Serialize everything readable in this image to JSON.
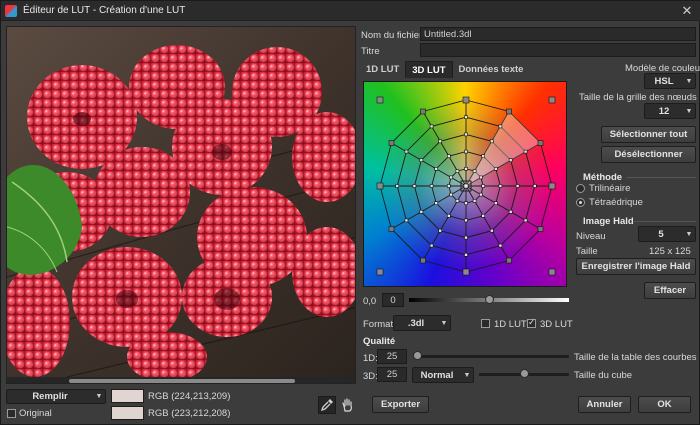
{
  "window": {
    "title": "Éditeur de LUT - Création d'une LUT"
  },
  "file": {
    "name_label": "Nom du fichier",
    "name_value": "Untitled.3dl",
    "title_label": "Titre",
    "title_value": ""
  },
  "tabs": [
    {
      "label": "1D LUT"
    },
    {
      "label": "3D LUT"
    },
    {
      "label": "Données texte"
    }
  ],
  "color_model": {
    "label": "Modèle de couleur",
    "value": "HSL"
  },
  "grid_size": {
    "label": "Taille de la grille des nœuds",
    "value": "12"
  },
  "buttons": {
    "select_all": "Sélectionner tout",
    "deselect": "Désélectionner",
    "save_hald": "Enregistrer l'image Hald",
    "clear": "Effacer",
    "export": "Exporter",
    "cancel": "Annuler",
    "ok": "OK"
  },
  "method": {
    "label": "Méthode",
    "options": [
      "Trilinéaire",
      "Tétraédrique"
    ],
    "selected": 1
  },
  "hald": {
    "label": "Image Hald",
    "level_label": "Niveau",
    "level_value": "5",
    "size_label": "Taille",
    "size_value": "125 x 125"
  },
  "brightness": {
    "label": "0,0",
    "value": "0",
    "fraction": 0.5
  },
  "format": {
    "label": "Format",
    "value": ".3dl",
    "cb_1d": "1D LUT",
    "cb_3d": "3D LUT",
    "cb_1d_checked": false,
    "cb_3d_checked": true
  },
  "quality": {
    "label": "Qualité",
    "d1_label": "1D:",
    "d1_value": "25",
    "d1_caption": "Taille de la table des courbes",
    "d1_fraction": 0.0,
    "d3_label": "3D:",
    "d3_value": "25",
    "d3_mode": "Normal",
    "d3_caption": "Taille du cube",
    "d3_fraction": 0.5
  },
  "bottom": {
    "fill_value": "Remplir",
    "rgb_current": "RGB (224,213,209)",
    "original_label": "Original",
    "rgb_original": "RGB (223,212,208)",
    "swatch_current": "#e0d5d1",
    "swatch_original": "#dfd4d0"
  },
  "colors": {
    "raspberry": "#d8283c",
    "leaf": "#3a8a2a",
    "wood": "#4a3c34"
  }
}
